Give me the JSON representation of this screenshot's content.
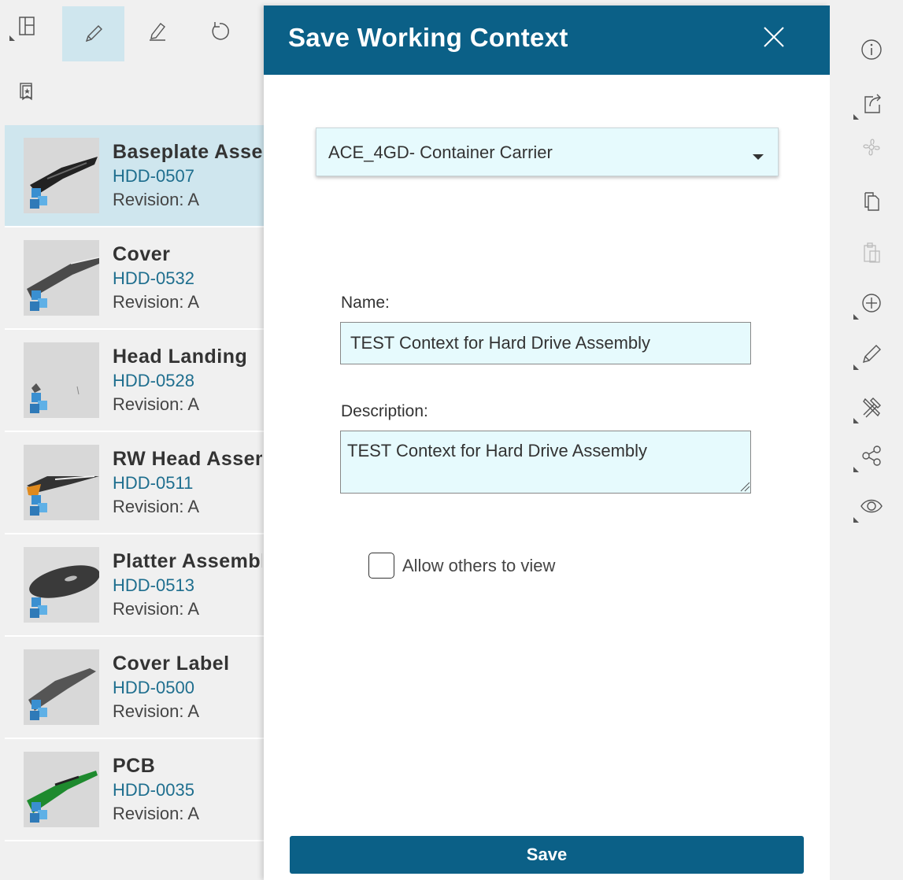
{
  "toolbar": {
    "icons": [
      "layout-panel-icon",
      "pencil-icon",
      "edit-icon",
      "undo-icon",
      "bookmark-list-icon"
    ]
  },
  "object_list": [
    {
      "title": "Baseplate Assembly",
      "id": "HDD-0507",
      "revision": "Revision:  A",
      "selected": true
    },
    {
      "title": "Cover",
      "id": "HDD-0532",
      "revision": "Revision:  A"
    },
    {
      "title": "Head Landing",
      "id": "HDD-0528",
      "revision": "Revision:  A"
    },
    {
      "title": "RW Head Assembly",
      "id": "HDD-0511",
      "revision": "Revision:  A"
    },
    {
      "title": "Platter Assembly",
      "id": "HDD-0513",
      "revision": "Revision:  A"
    },
    {
      "title": "Cover Label",
      "id": "HDD-0500",
      "revision": "Revision:  A"
    },
    {
      "title": "PCB",
      "id": "HDD-0035",
      "revision": "Revision:  A"
    }
  ],
  "dialog": {
    "title": "Save Working Context",
    "context_select_value": "ACE_4GD- Container Carrier",
    "name_label": "Name:",
    "name_value": "TEST Context for Hard Drive Assembly",
    "description_label": "Description:",
    "description_value": "TEST Context for Hard Drive Assembly",
    "allow_label": "Allow others to view",
    "allow_checked": false,
    "save_label": "Save"
  },
  "colors": {
    "header_bg": "#0b6087",
    "selected_bg": "#cfe6ee",
    "input_bg": "#e6fafd",
    "link_blue": "#1e6e8e"
  },
  "right_toolbar": {
    "icons": [
      "info-icon",
      "share-icon",
      "explode-icon",
      "copy-icon",
      "paste-icon",
      "add-icon",
      "pencil-icon",
      "tools-icon",
      "share-network-icon",
      "view-icon"
    ]
  }
}
